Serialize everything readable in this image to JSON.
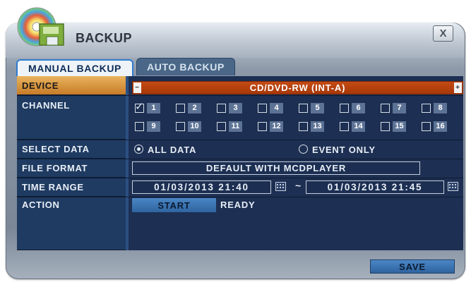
{
  "window": {
    "title": "BACKUP",
    "close_label": "X",
    "icon": "disc-backup-icon"
  },
  "tabs": [
    {
      "label": "MANUAL BACKUP",
      "active": true
    },
    {
      "label": "AUTO BACKUP",
      "active": false
    }
  ],
  "rows": {
    "device": {
      "label": "DEVICE",
      "value": "CD/DVD-RW (INT-A)"
    },
    "channel": {
      "label": "CHANNEL",
      "channels": [
        {
          "num": "1",
          "checked": true
        },
        {
          "num": "2",
          "checked": false
        },
        {
          "num": "3",
          "checked": false
        },
        {
          "num": "4",
          "checked": false
        },
        {
          "num": "5",
          "checked": false
        },
        {
          "num": "6",
          "checked": false
        },
        {
          "num": "7",
          "checked": false
        },
        {
          "num": "8",
          "checked": false
        },
        {
          "num": "9",
          "checked": false
        },
        {
          "num": "10",
          "checked": false
        },
        {
          "num": "11",
          "checked": false
        },
        {
          "num": "12",
          "checked": false
        },
        {
          "num": "13",
          "checked": false
        },
        {
          "num": "14",
          "checked": false
        },
        {
          "num": "15",
          "checked": false
        },
        {
          "num": "16",
          "checked": false
        }
      ]
    },
    "select_data": {
      "label": "SELECT DATA",
      "option_all": "ALL DATA",
      "option_event": "EVENT ONLY",
      "selected": "ALL DATA"
    },
    "file_format": {
      "label": "FILE FORMAT",
      "value": "DEFAULT WITH MCDPLAYER"
    },
    "time_range": {
      "label": "TIME RANGE",
      "start": "01/03/2013  21:40",
      "separator": "~",
      "end": "01/03/2013  21:45"
    },
    "action": {
      "label": "ACTION",
      "button": "START",
      "status": "READY"
    }
  },
  "footer": {
    "save_label": "SAVE"
  },
  "colors": {
    "device_bar": "#b8420e",
    "panel": "#1d2f52",
    "highlight": "#d98f3c",
    "button": "#3b74b4"
  }
}
